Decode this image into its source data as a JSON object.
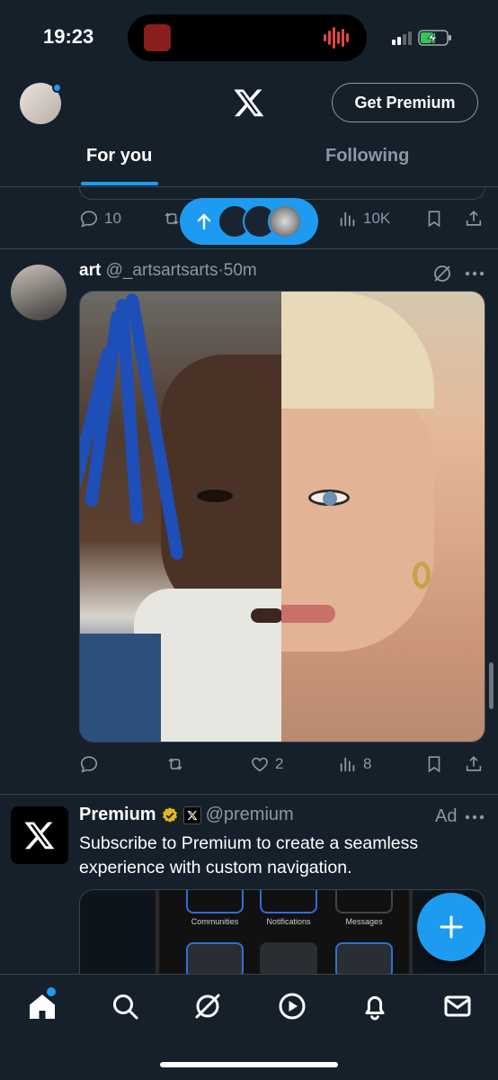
{
  "status_bar": {
    "time": "19:23"
  },
  "header": {
    "premium_button": "Get Premium",
    "tabs": [
      {
        "label": "For you",
        "active": true
      },
      {
        "label": "Following",
        "active": false
      }
    ]
  },
  "previous_tweet": {
    "replies": "10",
    "views": "10K"
  },
  "tweet": {
    "name": "art",
    "handle": "@_artsartsarts",
    "separator": "·",
    "time": "50m",
    "likes": "2",
    "views": "8"
  },
  "ad": {
    "name": "Premium",
    "handle": "@premium",
    "label": "Ad",
    "text": "Subscribe to Premium to create a seamless experience with custom navigation.",
    "mock_labels": [
      "Communities",
      "Notifications",
      "Messages"
    ]
  },
  "colors": {
    "accent": "#1d9bf0",
    "background": "#15202b",
    "border": "#38444d",
    "muted": "#8b98a5"
  },
  "icons": [
    "x-logo-icon",
    "reply-icon",
    "retweet-icon",
    "like-icon",
    "views-icon",
    "bookmark-icon",
    "share-icon",
    "grok-icon",
    "more-icon",
    "home-icon",
    "search-icon",
    "grok-nav-icon",
    "video-icon",
    "bell-icon",
    "mail-icon",
    "plus-icon"
  ]
}
